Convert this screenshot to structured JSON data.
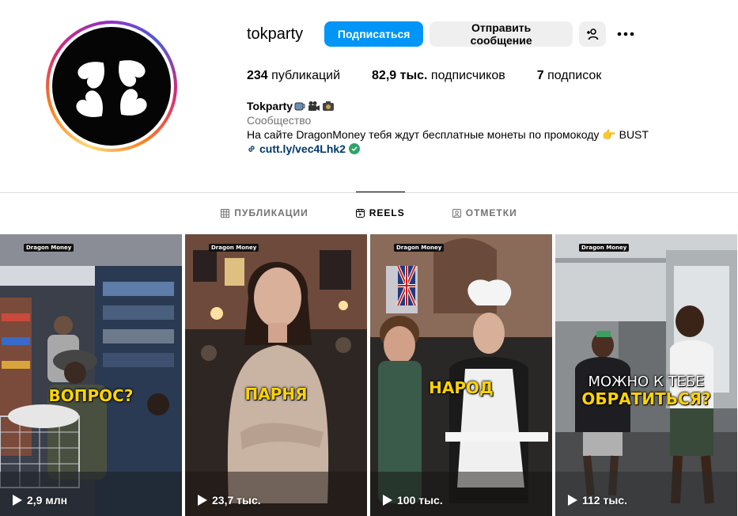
{
  "profile": {
    "username": "tokparty",
    "follow_label": "Подписаться",
    "message_label": "Отправить сообщение",
    "add_person_icon": "person-add-icon",
    "more_icon": "more-icon"
  },
  "stats": {
    "posts_value": "234",
    "posts_label": "публикаций",
    "followers_value": "82,9 тыс.",
    "followers_label": "подписчиков",
    "following_value": "7",
    "following_label": "подписок"
  },
  "bio": {
    "name": "Tokparty",
    "name_emojis": [
      "coffee-cup-icon",
      "movie-camera-icon",
      "photo-camera-icon"
    ],
    "category": "Сообщество",
    "text": "На сайте DragonMoney тебя ждут бесплатные монеты по промокоду 👉 BUST",
    "link": "cutt.ly/vec4Lhk2"
  },
  "tabs": [
    {
      "label": "ПУБЛИКАЦИИ",
      "icon": "grid-icon",
      "active": false
    },
    {
      "label": "REELS",
      "icon": "reels-icon",
      "active": true
    },
    {
      "label": "ОТМЕТКИ",
      "icon": "tagged-icon",
      "active": false
    }
  ],
  "reels": [
    {
      "brand": "Dragon Money",
      "caption": "ВОПРОС?",
      "caption2": "",
      "views": "2,9 млн"
    },
    {
      "brand": "Dragon Money",
      "caption": "ПАРНЯ",
      "caption2": "",
      "views": "23,7 тыс."
    },
    {
      "brand": "Dragon Money",
      "caption": "НАРОД",
      "caption2": "",
      "views": "100 тыс."
    },
    {
      "brand": "Dragon Money",
      "caption": "ОБРАТИТЬСЯ?",
      "caption2": "МОЖНО К ТЕБЕ",
      "views": "112 тыс."
    }
  ],
  "colors": {
    "follow_button": "#0095f6",
    "secondary_button": "#efefef",
    "link": "#00376b",
    "caption": "#ffd400"
  }
}
